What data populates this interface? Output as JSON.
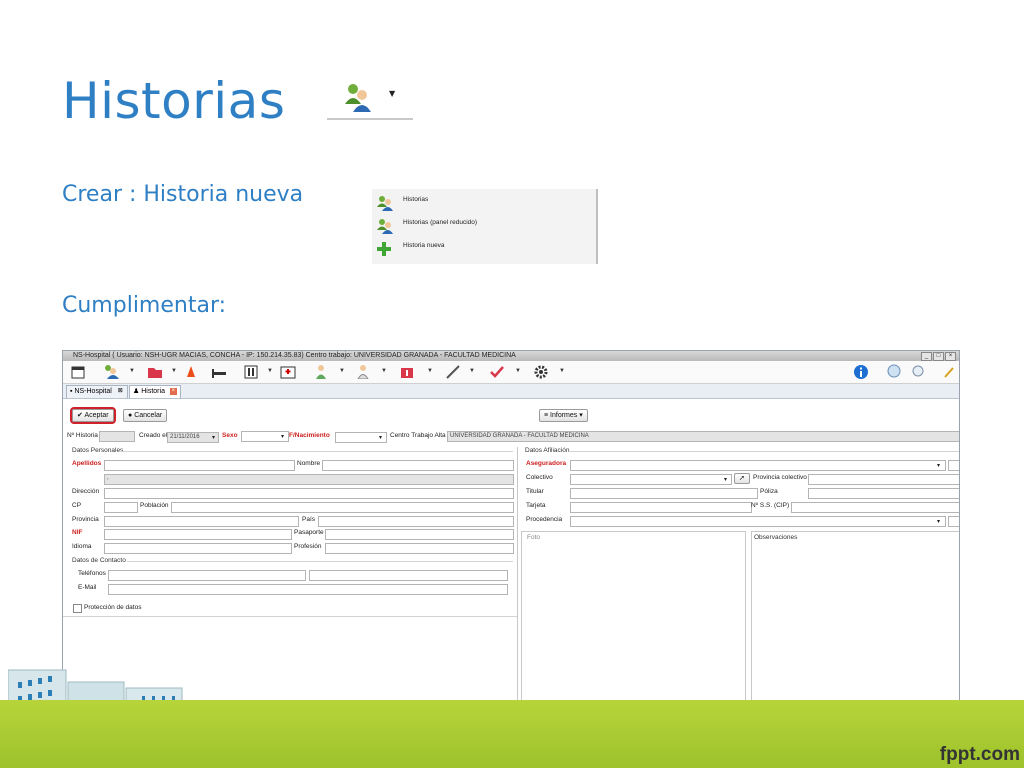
{
  "slide": {
    "title": "Historias",
    "create_label": "Crear :  Historia nueva",
    "fill_label": "Cumplimentar:",
    "footer_brand": "fppt.com"
  },
  "menu": {
    "items": [
      {
        "label": "Historias",
        "icon": "users-icon"
      },
      {
        "label": "Historias (panel reducido)",
        "icon": "users-icon"
      },
      {
        "label": "Historia nueva",
        "icon": "plus-icon"
      }
    ]
  },
  "app": {
    "window_title": "NS-Hospital  ( Usuario: NSH-UGR MACIAS, CONCHA - IP: 150.214.35.83)    Centro trabajo: UNIVERSIDAD GRANADA - FACULTAD MEDICINA",
    "tabs": [
      {
        "label": "NS-Hospital",
        "active": false
      },
      {
        "label": "Historia",
        "active": true
      }
    ],
    "buttons": {
      "accept": "Aceptar",
      "cancel": "Cancelar",
      "reports": "Informes"
    },
    "header_fields": {
      "nhistoria_label": "Nº Historia",
      "created_label": "Creado el",
      "created_value": "21/11/2016",
      "sex_label": "Sexo",
      "birth_label": "F/Nacimiento",
      "center_label": "Centro Trabajo Alta",
      "center_value": "UNIVERSIDAD GRANADA - FACULTAD MEDICINA"
    },
    "personal": {
      "section": "Datos Personales",
      "surnames": "Apellidos",
      "name": "Nombre",
      "comma_value": ",",
      "address": "Dirección",
      "cp": "CP",
      "town": "Población",
      "province": "Provincia",
      "country": "País",
      "nif": "NIF",
      "passport": "Pasaporte",
      "language": "Idioma",
      "profession": "Profesión"
    },
    "contact": {
      "section": "Datos de Contacto",
      "phones": "Teléfonos",
      "email": "E-Mail",
      "privacy": "Protección de datos"
    },
    "affiliation": {
      "section": "Datos Afiliación",
      "insurer": "Aseguradora",
      "collective": "Colectivo",
      "collective_province": "Provincia colectivo",
      "holder": "Titular",
      "policy": "Póliza",
      "card": "Tarjeta",
      "ss": "Nº S.S. (CIP)",
      "origin": "Procedencia"
    },
    "photo": "Foto",
    "observations": "Observaciones"
  },
  "colors": {
    "title_blue": "#2e7fc4",
    "required_red": "#cc2020",
    "ground_green": "#9dc22c"
  }
}
